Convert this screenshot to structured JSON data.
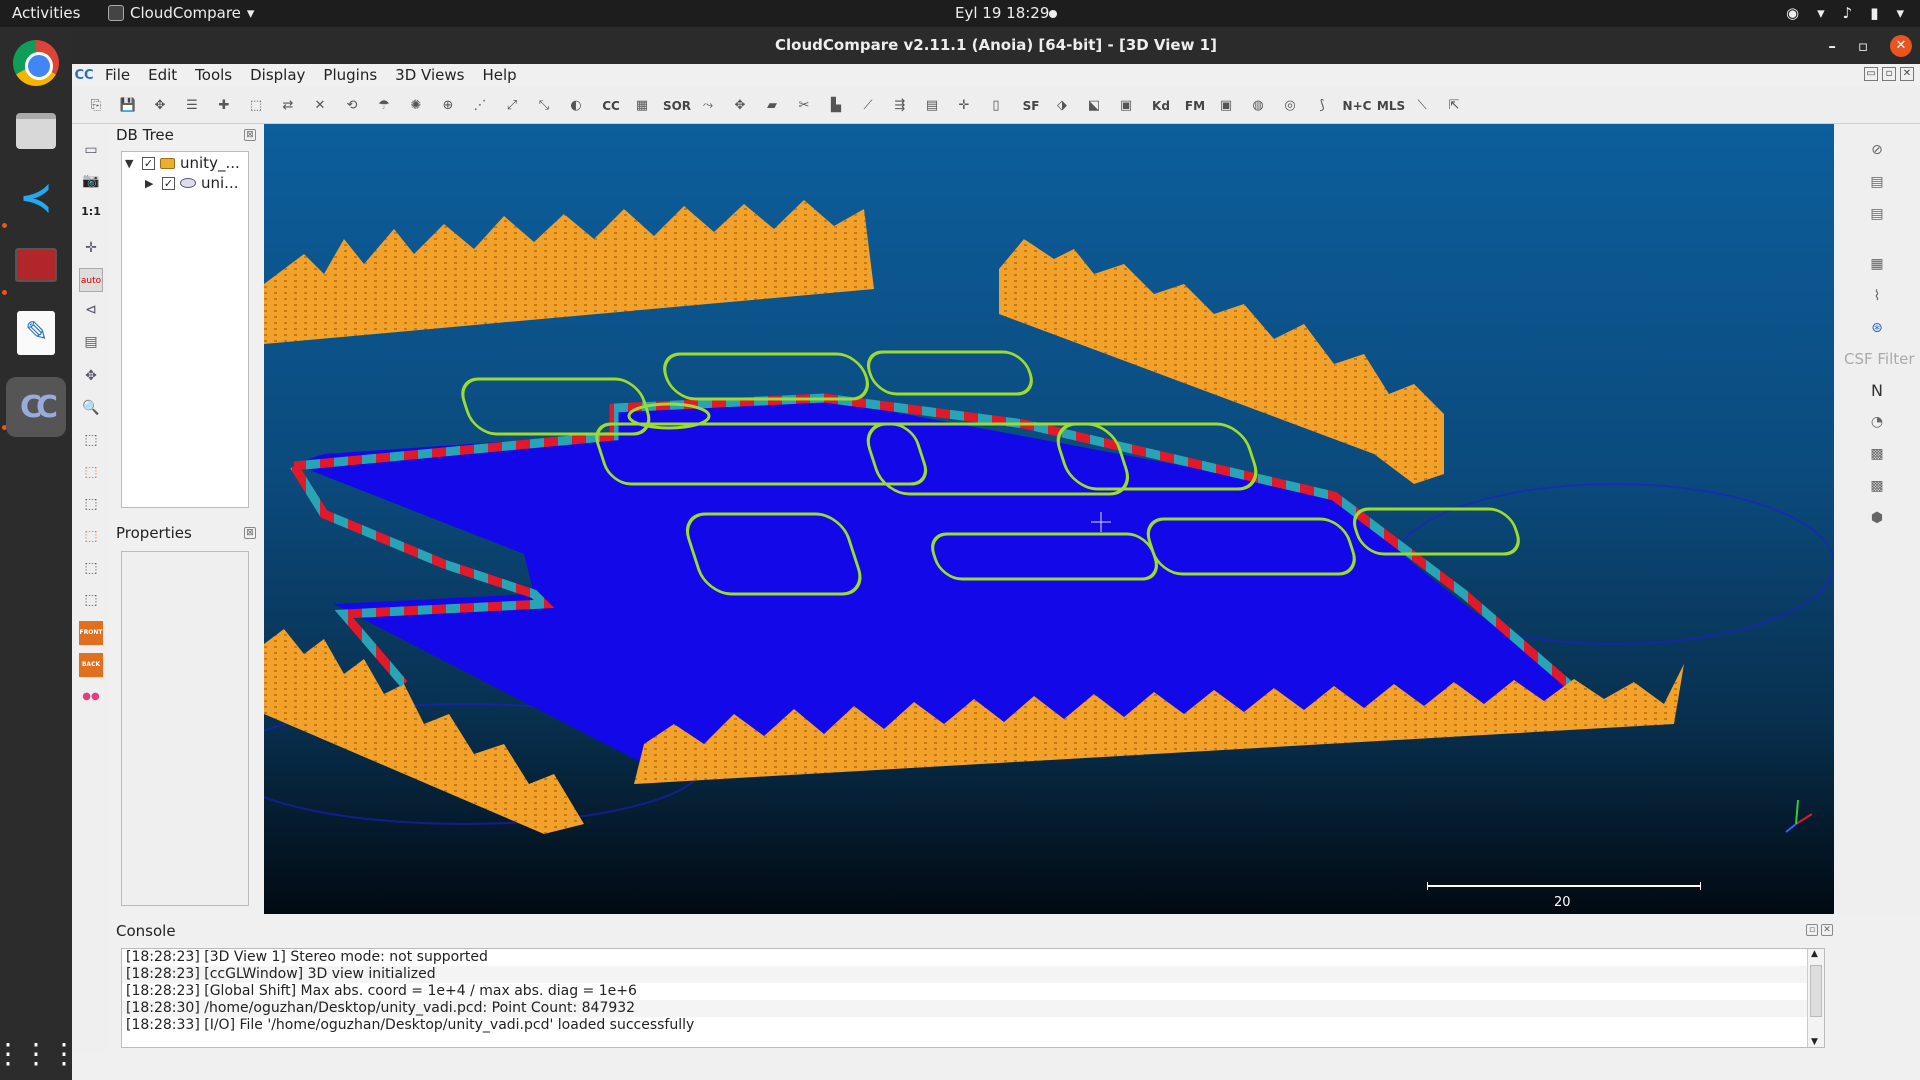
{
  "topbar": {
    "activities": "Activities",
    "app_name": "CloudCompare",
    "app_menu_arrow": "▾",
    "clock": "Eyl 19  18:29",
    "tray_icons": [
      "network-icon",
      "wifi-icon",
      "volume-icon",
      "battery-icon",
      "power-icon"
    ],
    "tray_glyphs": [
      "◉",
      "▾",
      "♪",
      "▮",
      "▾"
    ]
  },
  "dock": {
    "items": [
      "chrome-icon",
      "files-icon",
      "vscode-icon",
      "calculator-icon",
      "text-editor-icon",
      "cloudcompare-icon"
    ],
    "vscode_glyph": "≺",
    "cc_glyph": "CC",
    "apps_grid_glyph": "⋮⋮⋮"
  },
  "window": {
    "title": "CloudCompare v2.11.1 (Anoia) [64-bit] - [3D View 1]",
    "minimize": "–",
    "maximize": "▫",
    "close": "✕"
  },
  "menubar": {
    "logo": "CC",
    "items": [
      "File",
      "Edit",
      "Tools",
      "Display",
      "Plugins",
      "3D Views",
      "Help"
    ],
    "mdi_buttons": [
      "▭",
      "▫",
      "✕"
    ]
  },
  "toolbar": {
    "text_buttons": {
      "sor": "SOR",
      "sf": "SF",
      "kd": "Kd",
      "fm": "FM",
      "nc": "N+C",
      "mls": "MLS",
      "cc": "CC"
    },
    "glyph_buttons": [
      "⎘",
      "💾",
      "✥",
      "☰",
      "✚",
      "⬚",
      "⇄",
      "✕",
      "⟲",
      "☂",
      "✺",
      "⊕",
      "⋰",
      "⤢",
      "⤡",
      "◐",
      "▦",
      "⤳",
      "✥",
      "▰",
      "✂",
      "▙",
      "⟋",
      "⇶",
      "▤",
      "✛",
      "▯",
      "⬗",
      "⬕",
      "▣",
      "▣",
      "◍",
      "◎",
      "⟆",
      "⟍",
      "⇱"
    ]
  },
  "left_tools": {
    "one_to_one": "1:1",
    "auto": "auto",
    "front": "FRONT",
    "back": "BACK",
    "glyphs": [
      "▭",
      "📷",
      "✛",
      "⊲",
      "▤",
      "✥",
      "🔍",
      "⬚",
      "⬚",
      "⬚",
      "⬚",
      "⬚",
      "⬚",
      "●●"
    ]
  },
  "db_tree": {
    "title": "DB Tree",
    "close": "⊠",
    "items": [
      {
        "label": "unity_...",
        "expand": "▼",
        "checked": "✓"
      },
      {
        "label": "uni...",
        "expand": "▶",
        "checked": "✓"
      }
    ]
  },
  "properties": {
    "title": "Properties",
    "close": "⊠"
  },
  "view3d": {
    "scale_value": "20",
    "colors": {
      "ground": "#1208e8",
      "stands": "#f2a12a",
      "barrier_red": "#e0192b",
      "barrier_teal": "#2aa3b4",
      "lines": "#9cdc2e",
      "lines_edge": "#e05a8a"
    }
  },
  "right_tools": {
    "csf_label": "CSF Filter",
    "n_label": "N",
    "glyphs": [
      "⊘",
      "▤",
      "▤",
      "▦",
      "⌇",
      "⊛",
      "↑",
      "◔",
      "▩",
      "▩",
      "⬢"
    ]
  },
  "console": {
    "title": "Console",
    "controls": [
      "▫",
      "✕"
    ],
    "lines": [
      "[18:28:23] [3D View 1] Stereo mode: not supported",
      "[18:28:23] [ccGLWindow] 3D view initialized",
      "[18:28:23] [Global Shift] Max abs. coord = 1e+4 / max abs. diag = 1e+6",
      "[18:28:30] /home/oguzhan/Desktop/unity_vadi.pcd: Point Count: 847932",
      "[18:28:33] [I/O] File '/home/oguzhan/Desktop/unity_vadi.pcd' loaded successfully"
    ],
    "scroll_up": "▲",
    "scroll_down": "▼"
  }
}
